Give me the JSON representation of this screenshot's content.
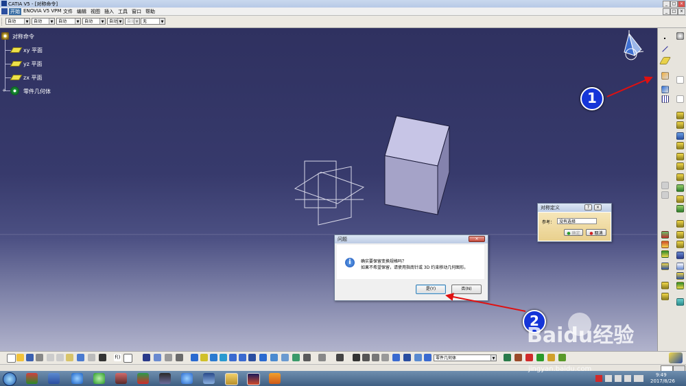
{
  "titlebar": {
    "title": "CATIA V5 - [对称命令]"
  },
  "menubar": {
    "items": [
      {
        "label": "开始"
      },
      {
        "label": "ENOVIA V5 VPM"
      },
      {
        "label": "文件"
      },
      {
        "label": "编辑"
      },
      {
        "label": "视图"
      },
      {
        "label": "插入"
      },
      {
        "label": "工具"
      },
      {
        "label": "窗口"
      },
      {
        "label": "帮助"
      }
    ]
  },
  "formatbar": {
    "combos": [
      "自动",
      "自动",
      "自动",
      "自动",
      "自动",
      "自动",
      "自动",
      "无"
    ]
  },
  "tree": {
    "root": "对称命令",
    "items": [
      {
        "label": "xy 平面"
      },
      {
        "label": "yz 平面"
      },
      {
        "label": "zx 平面"
      }
    ],
    "body": "零件几何体"
  },
  "sym_dialog": {
    "title": "对称定义",
    "ref_label": "参考：",
    "ref_value": "没有选择",
    "ok": "确定",
    "cancel": "取消"
  },
  "question_dialog": {
    "title": "问题",
    "line1": "确实要保留变换规格吗？",
    "line2": "如果不希望保留，请使用指南针或 3D 约束移动几何图形。",
    "yes": "是(Y)",
    "no": "否(N)"
  },
  "markers": {
    "one": "1",
    "two": "2"
  },
  "bottombar": {
    "body_combo": "零件几何体"
  },
  "watermark": {
    "brand": "Baidu经验",
    "url": "jingyan.baidu.com"
  },
  "taskbar": {
    "time": "9:49",
    "date": "2017/8/26"
  },
  "colors": {
    "viewport_top": "#2f3160",
    "viewport_bottom": "#b1b3cc",
    "marker": "#1535d8",
    "arrow": "#e01010"
  }
}
